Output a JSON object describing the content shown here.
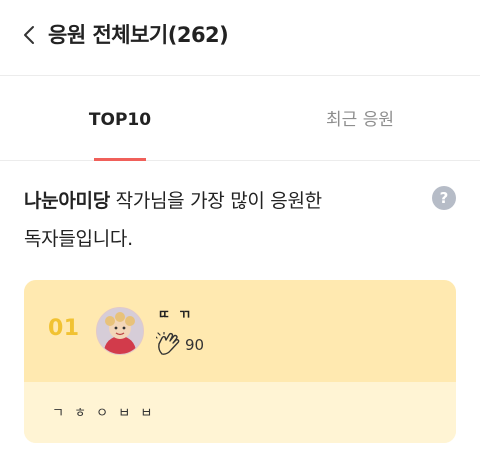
{
  "header": {
    "title": "응원 전체보기(262)"
  },
  "tabs": [
    {
      "label": "TOP10",
      "active": true
    },
    {
      "label": "최근 응원",
      "active": false
    }
  ],
  "description": {
    "author_name": "나눈아미당",
    "line1_rest": " 작가님을 가장 많이 응원한",
    "line2": "독자들입니다."
  },
  "help": {
    "glyph": "?"
  },
  "supporters": [
    {
      "rank": "01",
      "name": "ㄸ ㄲ",
      "claps": "90",
      "message": "ㄱ ㅎ ㅇ ㅂ ㅂ"
    }
  ],
  "colors": {
    "accent": "#f0605a",
    "rank": "#f1c232",
    "card_top": "#ffe9b0",
    "card_bottom": "#fff4d4",
    "help_icon": "#b6bcc7"
  }
}
